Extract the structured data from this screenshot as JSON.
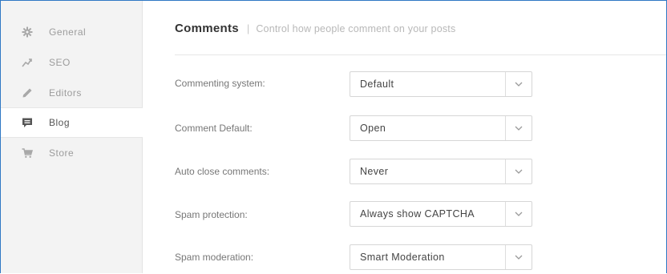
{
  "sidebar": {
    "items": [
      {
        "label": "General",
        "icon": "gear-icon"
      },
      {
        "label": "SEO",
        "icon": "trend-line-icon"
      },
      {
        "label": "Editors",
        "icon": "pencil-icon"
      },
      {
        "label": "Blog",
        "icon": "comment-icon",
        "active": true
      },
      {
        "label": "Store",
        "icon": "cart-icon"
      }
    ]
  },
  "header": {
    "title": "Comments",
    "separator": "|",
    "subtitle": "Control how people comment on your posts"
  },
  "settings": [
    {
      "label": "Commenting system:",
      "value": "Default"
    },
    {
      "label": "Comment Default:",
      "value": "Open"
    },
    {
      "label": "Auto close comments:",
      "value": "Never"
    },
    {
      "label": "Spam protection:",
      "value": "Always show CAPTCHA"
    },
    {
      "label": "Spam moderation:",
      "value": "Smart Moderation"
    }
  ],
  "colors": {
    "sidebar_bg": "#f3f3f3",
    "frame_border": "#2f78c4",
    "muted_text": "#9c9c9c",
    "icon_gray": "#a8a8a8",
    "active_icon": "#555555"
  }
}
